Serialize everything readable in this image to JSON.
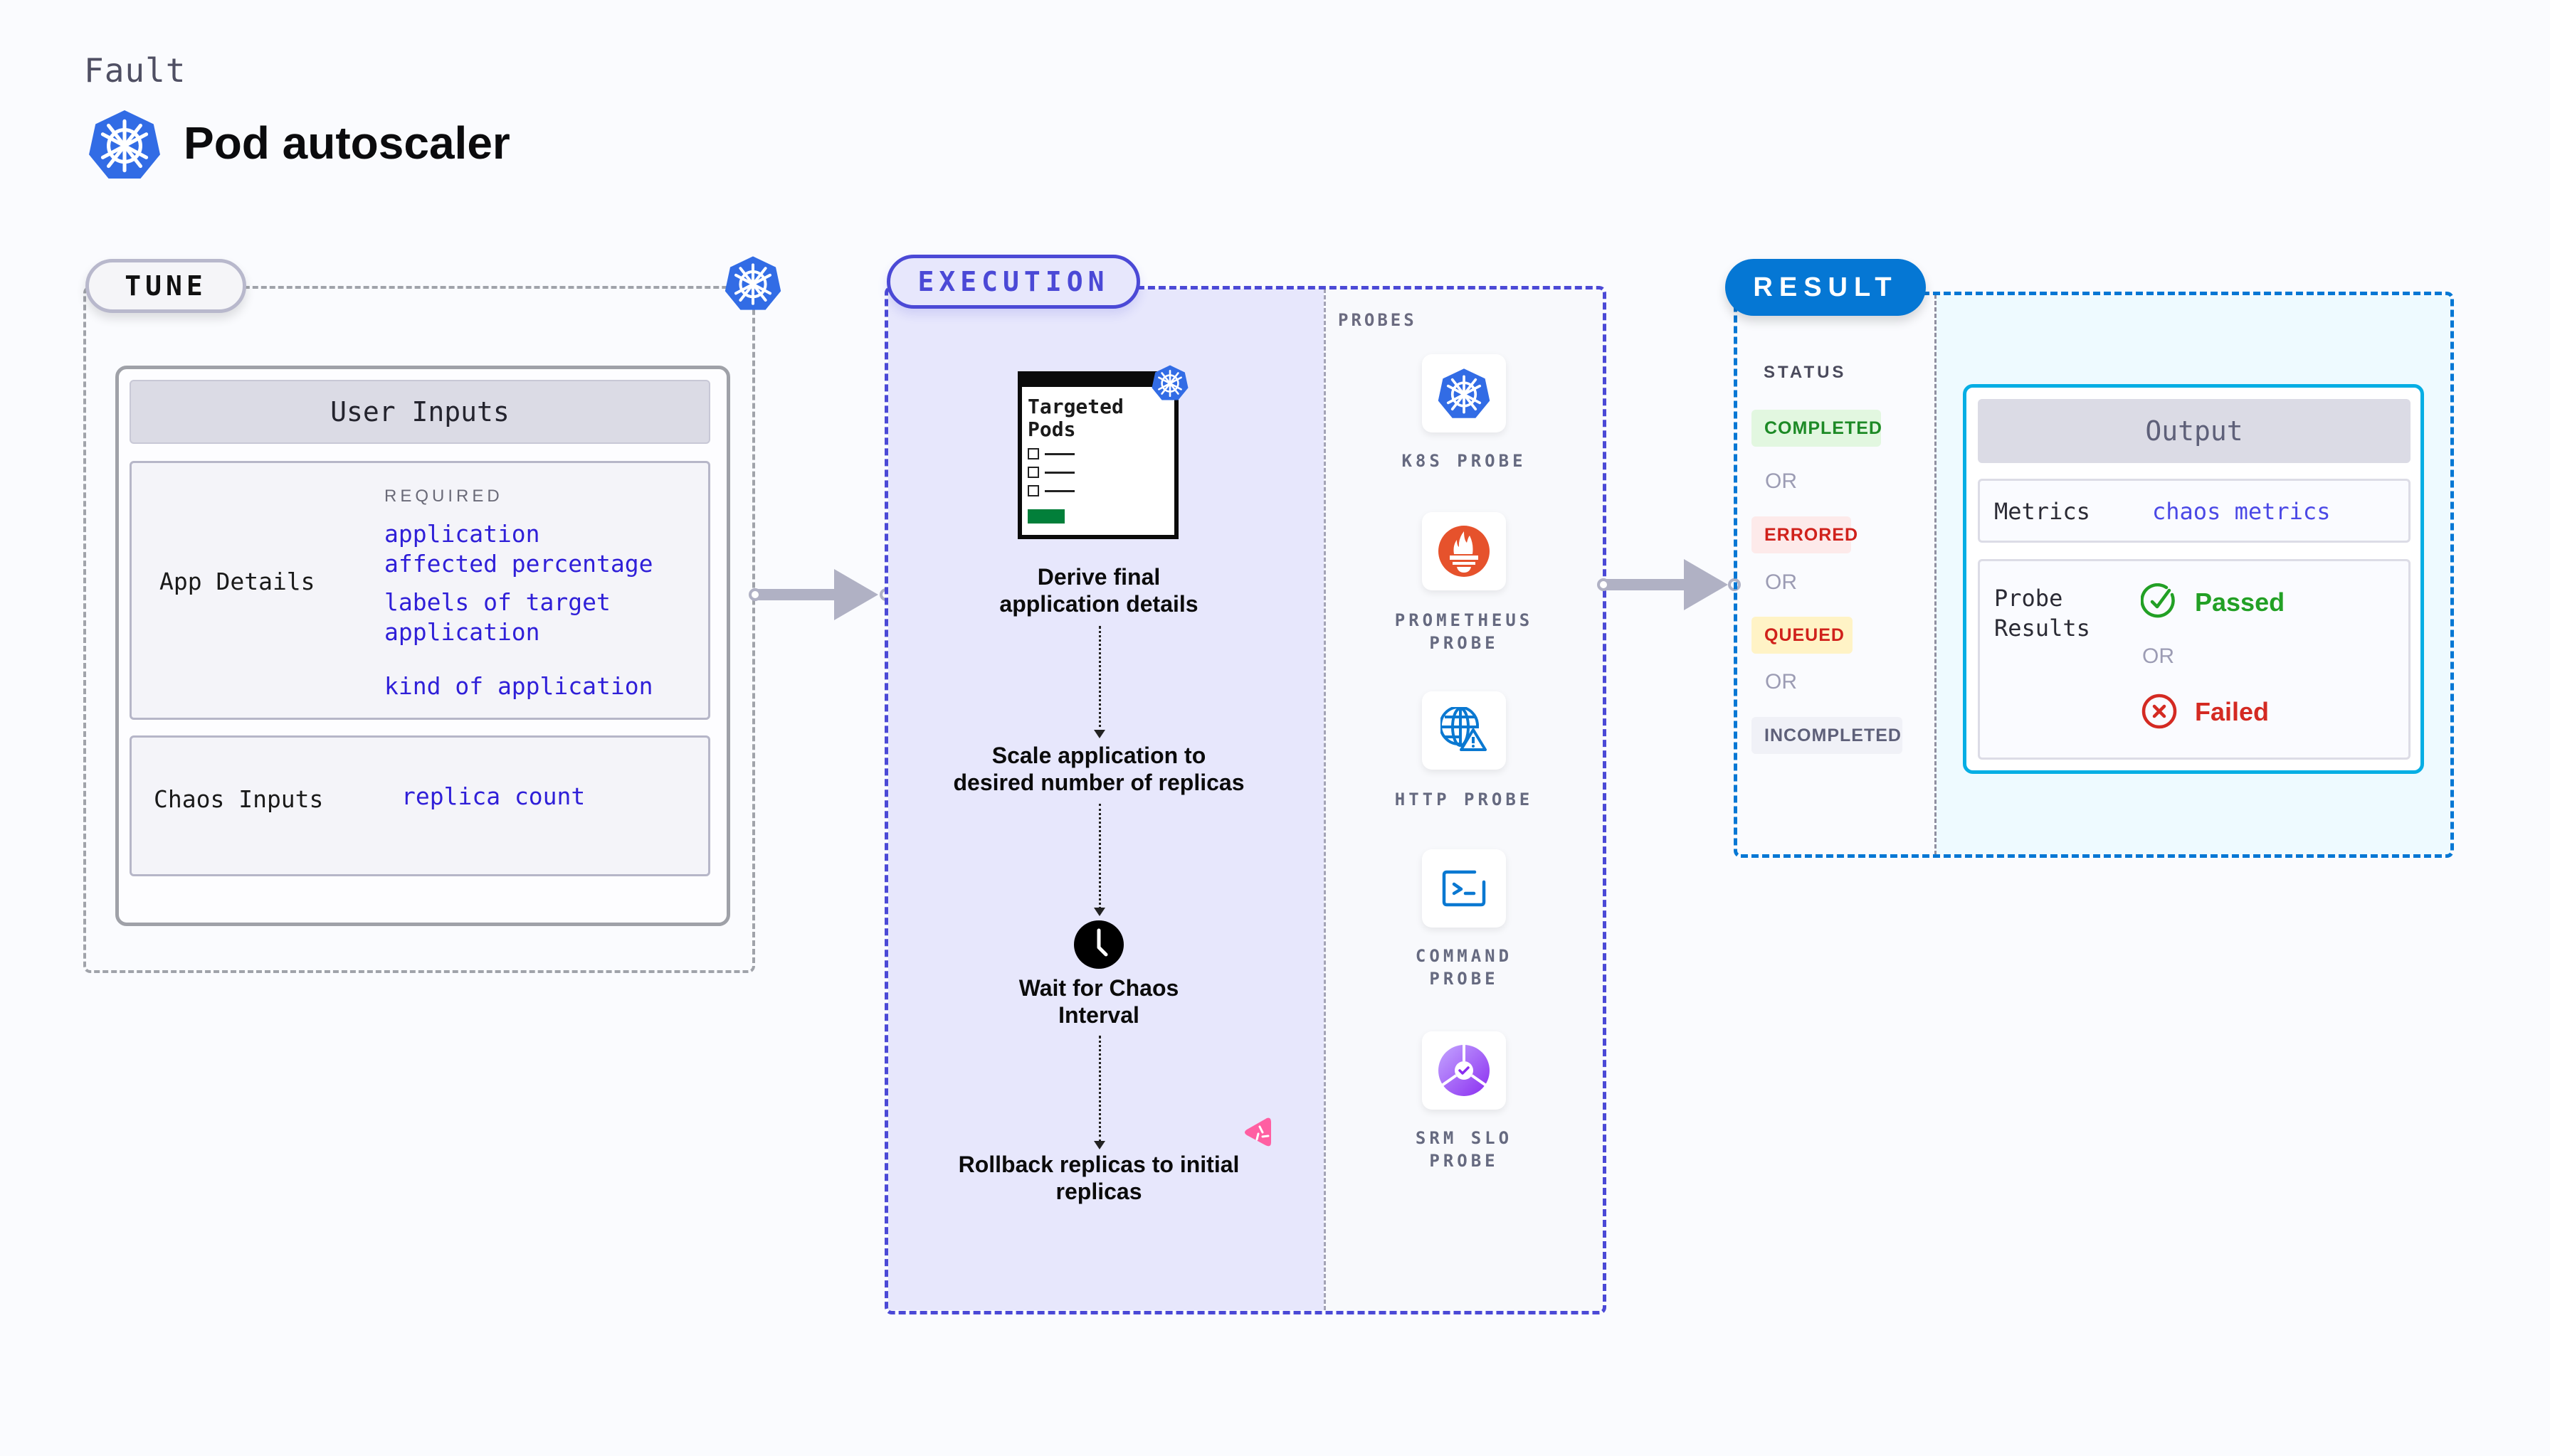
{
  "header": {
    "category": "Fault",
    "title": "Pod autoscaler",
    "title_icon": "kubernetes-icon"
  },
  "tune": {
    "label": "TUNE",
    "corner_icon": "kubernetes-icon",
    "user_inputs": {
      "title": "User Inputs",
      "app_details": {
        "label": "App Details",
        "required_label": "REQUIRED",
        "params": [
          "application",
          "affected percentage",
          "labels of target",
          "application",
          "kind of application"
        ]
      },
      "chaos_inputs": {
        "label": "Chaos Inputs",
        "params": [
          "replica count"
        ]
      }
    }
  },
  "execution": {
    "label": "EXECUTION",
    "targeted_card": {
      "title_line1": "Targeted",
      "title_line2": "Pods",
      "badge_icon": "kubernetes-icon"
    },
    "steps": [
      {
        "line1": "Derive final",
        "line2": "application details"
      },
      {
        "line1": "Scale application to",
        "line2": "desired number of replicas"
      },
      {
        "line1": "Wait for Chaos",
        "line2": "Interval",
        "icon": "clock-icon"
      },
      {
        "line1": "Rollback replicas to initial",
        "line2": "replicas"
      }
    ],
    "chaos_badge_icon": "litmus-chaos-icon",
    "probes": {
      "label": "PROBES",
      "items": [
        {
          "line1": "K8S PROBE",
          "line2": "",
          "icon": "kubernetes-icon"
        },
        {
          "line1": "PROMETHEUS",
          "line2": "PROBE",
          "icon": "prometheus-icon"
        },
        {
          "line1": "HTTP PROBE",
          "line2": "",
          "icon": "globe-warning-icon"
        },
        {
          "line1": "COMMAND",
          "line2": "PROBE",
          "icon": "terminal-icon"
        },
        {
          "line1": "SRM SLO",
          "line2": "PROBE",
          "icon": "slo-check-icon"
        }
      ]
    }
  },
  "result": {
    "label": "RESULT",
    "status": {
      "label": "STATUS",
      "badges": [
        {
          "text": "COMPLETED",
          "color": "#1d8a26",
          "bg": "#e2f7e0"
        },
        {
          "text": "ERRORED",
          "color": "#d0211b",
          "bg": "#fdeaea"
        },
        {
          "text": "QUEUED",
          "color": "#d0211b",
          "bg": "#fff3c6"
        },
        {
          "text": "INCOMPLETED",
          "color": "#5e6079",
          "bg": "#f0f1f7"
        }
      ],
      "separator": "OR"
    },
    "output": {
      "title": "Output",
      "metrics_label": "Metrics",
      "metrics_value": "chaos metrics",
      "probe_results_label_line1": "Probe",
      "probe_results_label_line2": "Results",
      "passed": "Passed",
      "separator": "OR",
      "failed": "Failed"
    }
  },
  "colors": {
    "execution_accent": "#4b49d6",
    "result_accent": "#0577d4",
    "output_border": "#05aee4",
    "param_blue": "#2f1fd8",
    "kubernetes_blue": "#326ce5",
    "prometheus_orange": "#e6522c",
    "passed_green": "#22a025",
    "failed_red": "#d42a22"
  }
}
